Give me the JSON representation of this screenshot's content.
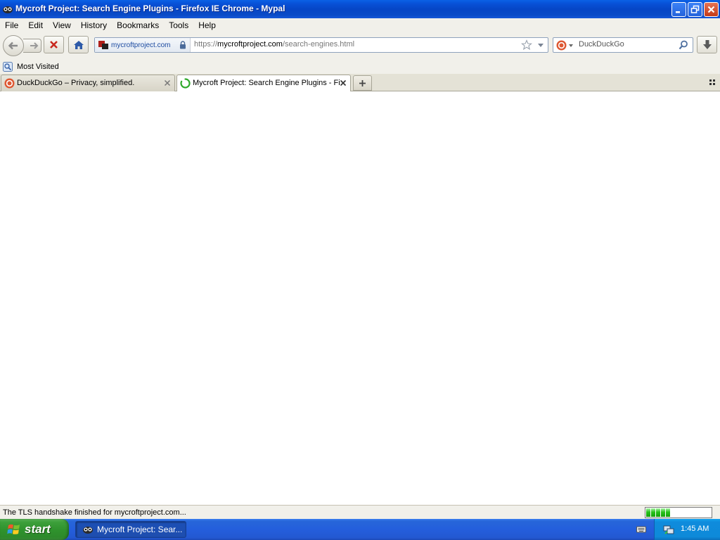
{
  "window": {
    "title": "Mycroft Project: Search Engine Plugins - Firefox IE Chrome - Mypal",
    "app_icon": "mypal-icon",
    "controls": [
      "minimize-icon",
      "restore-icon",
      "close-icon"
    ]
  },
  "menu": {
    "items": [
      "File",
      "Edit",
      "View",
      "History",
      "Bookmarks",
      "Tools",
      "Help"
    ]
  },
  "navbar": {
    "back_icon": "back-arrow-icon",
    "forward_icon": "forward-arrow-icon",
    "stop_icon": "stop-icon",
    "home_icon": "home-icon",
    "identity_site": "mycroftproject.com",
    "url_scheme": "https://",
    "url_host": "mycroftproject.com",
    "url_path": "/search-engines.html",
    "search_placeholder": "DuckDuckGo",
    "download_icon": "download-arrow-icon"
  },
  "bookmarks": {
    "items": [
      {
        "label": "Most Visited",
        "icon": "bookmark-folder-icon"
      }
    ]
  },
  "tabs": [
    {
      "label": "DuckDuckGo – Privacy, simplified.",
      "active": false,
      "icon": "duckduckgo-icon"
    },
    {
      "label": "Mycroft Project: Search Engine Plugins - Fi...",
      "active": true,
      "icon": "loading-spinner-icon"
    }
  ],
  "status": {
    "text": "The TLS handshake finished for mycroftproject.com...",
    "progress_fraction": 0.35
  },
  "taskbar": {
    "start_label": "start",
    "task_label": "Mycroft Project: Sear...",
    "clock": "1:45 AM"
  },
  "colors": {
    "titlebar_blue": "#0A4BC7",
    "taskbar_blue": "#245EDC",
    "start_green": "#2F922D",
    "close_red": "#C43A18",
    "progress_green": "#26C21A"
  }
}
